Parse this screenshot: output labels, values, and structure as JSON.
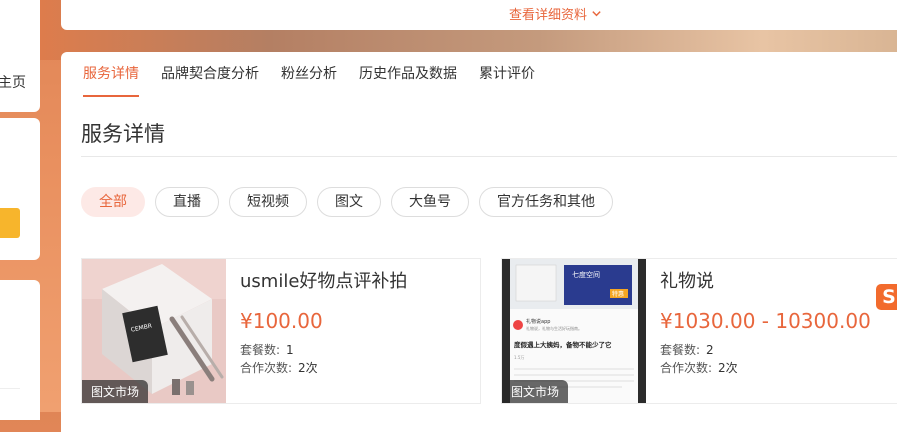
{
  "left_panel": {
    "home_label_fragment": "主页"
  },
  "top": {
    "more_details": "查看详细资料"
  },
  "tabs": [
    {
      "label": "服务详情",
      "active": true
    },
    {
      "label": "品牌契合度分析"
    },
    {
      "label": "粉丝分析"
    },
    {
      "label": "历史作品及数据"
    },
    {
      "label": "累计评价"
    }
  ],
  "section": {
    "title": "服务详情"
  },
  "filters": [
    {
      "label": "全部",
      "active": true
    },
    {
      "label": "直播"
    },
    {
      "label": "短视频"
    },
    {
      "label": "图文"
    },
    {
      "label": "大鱼号"
    },
    {
      "label": "官方任务和其他"
    }
  ],
  "cards": [
    {
      "name": "usmile好物点评补拍",
      "price": "¥100.00",
      "package_label": "套餐数:",
      "package_count": "1",
      "coop_label": "合作次数:",
      "coop_count": "2次",
      "tag": "图文市场"
    },
    {
      "name": "礼物说",
      "price": "¥1030.00 - 10300.00",
      "package_label": "套餐数:",
      "package_count": "2",
      "coop_label": "合作次数:",
      "coop_count": "2次",
      "tag": "图文市场",
      "thumb_texts": {
        "app_name": "礼物说app",
        "app_sub": "礼物说，礼物与生活好玩指南。",
        "headline": "度假遇上大姨妈，备物不能少了它",
        "product_brand": "七度空间",
        "product_badge": "特惠",
        "reads": "1.5万"
      }
    }
  ],
  "colors": {
    "accent": "#e8663c",
    "chip_active_bg": "#fde9e6"
  }
}
